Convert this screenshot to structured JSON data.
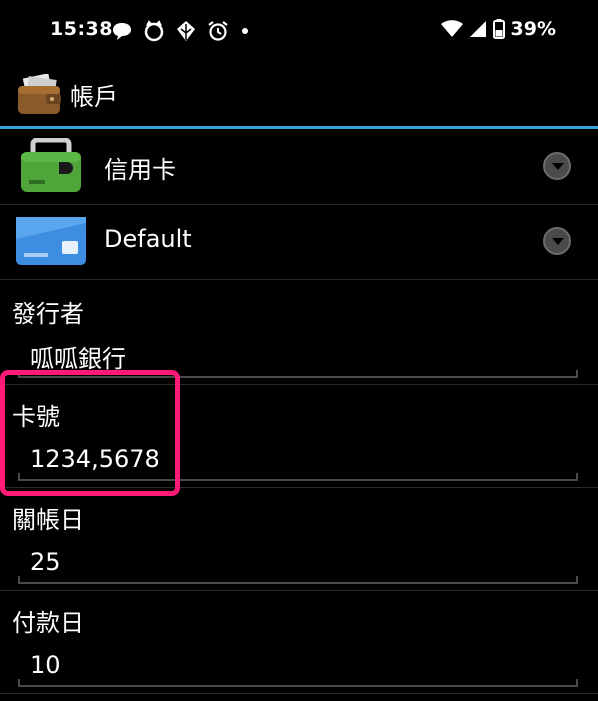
{
  "status_bar": {
    "time": "15:38",
    "notification_icons": [
      "speech-bubble-icon",
      "cat-face-icon",
      "leaf-icon",
      "alarm-clock-icon",
      "dot-icon"
    ],
    "battery_percent": "39%"
  },
  "app_bar": {
    "icon": "wallet-icon",
    "title": "帳戶"
  },
  "spinners": [
    {
      "icon": "green-card-icon",
      "label": "信用卡"
    },
    {
      "icon": "blue-card-icon",
      "label": "Default"
    }
  ],
  "fields": {
    "issuer": {
      "label": "發行者",
      "value": "呱呱銀行"
    },
    "card_number": {
      "label": "卡號",
      "value": "1234,5678"
    },
    "closing_day": {
      "label": "關帳日",
      "value": "25"
    },
    "payment_day": {
      "label": "付款日",
      "value": "10"
    }
  },
  "colors": {
    "accent_divider": "#36a2e0",
    "highlight": "#ff1a78",
    "background": "#000000"
  }
}
